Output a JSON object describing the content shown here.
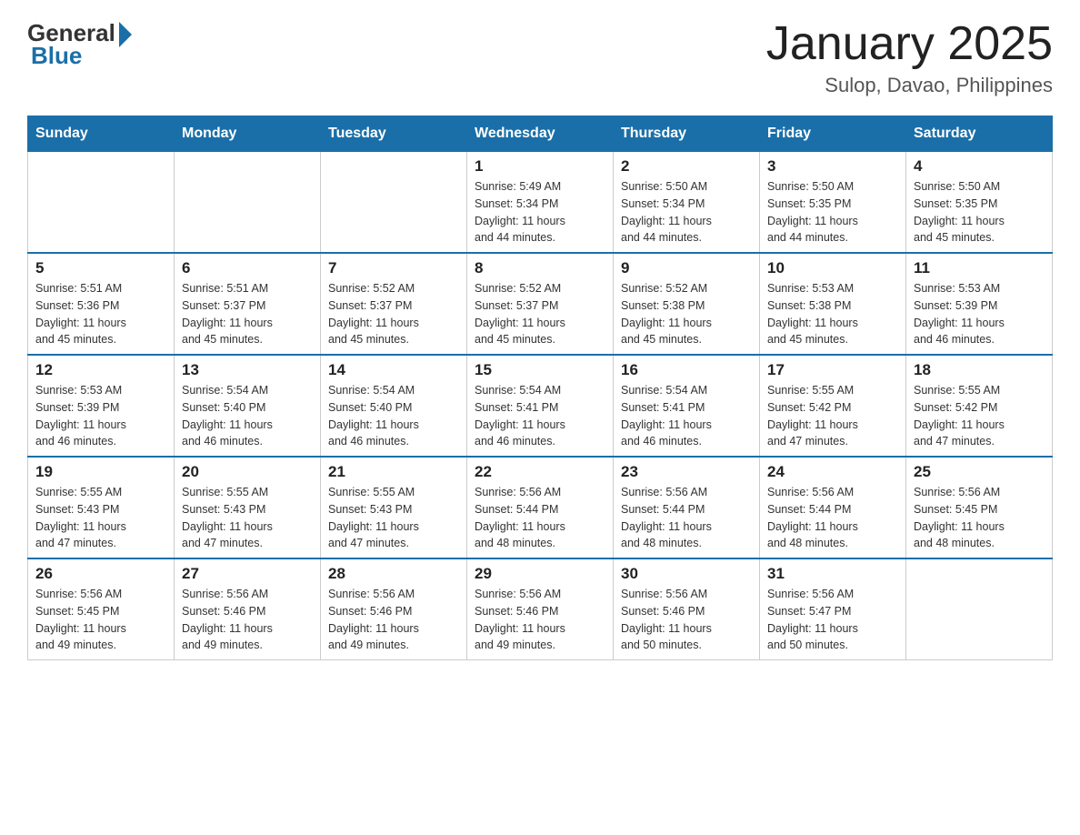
{
  "header": {
    "logo_general": "General",
    "logo_blue": "Blue",
    "month_title": "January 2025",
    "location": "Sulop, Davao, Philippines"
  },
  "weekdays": [
    "Sunday",
    "Monday",
    "Tuesday",
    "Wednesday",
    "Thursday",
    "Friday",
    "Saturday"
  ],
  "weeks": [
    [
      {
        "day": "",
        "info": ""
      },
      {
        "day": "",
        "info": ""
      },
      {
        "day": "",
        "info": ""
      },
      {
        "day": "1",
        "info": "Sunrise: 5:49 AM\nSunset: 5:34 PM\nDaylight: 11 hours\nand 44 minutes."
      },
      {
        "day": "2",
        "info": "Sunrise: 5:50 AM\nSunset: 5:34 PM\nDaylight: 11 hours\nand 44 minutes."
      },
      {
        "day": "3",
        "info": "Sunrise: 5:50 AM\nSunset: 5:35 PM\nDaylight: 11 hours\nand 44 minutes."
      },
      {
        "day": "4",
        "info": "Sunrise: 5:50 AM\nSunset: 5:35 PM\nDaylight: 11 hours\nand 45 minutes."
      }
    ],
    [
      {
        "day": "5",
        "info": "Sunrise: 5:51 AM\nSunset: 5:36 PM\nDaylight: 11 hours\nand 45 minutes."
      },
      {
        "day": "6",
        "info": "Sunrise: 5:51 AM\nSunset: 5:37 PM\nDaylight: 11 hours\nand 45 minutes."
      },
      {
        "day": "7",
        "info": "Sunrise: 5:52 AM\nSunset: 5:37 PM\nDaylight: 11 hours\nand 45 minutes."
      },
      {
        "day": "8",
        "info": "Sunrise: 5:52 AM\nSunset: 5:37 PM\nDaylight: 11 hours\nand 45 minutes."
      },
      {
        "day": "9",
        "info": "Sunrise: 5:52 AM\nSunset: 5:38 PM\nDaylight: 11 hours\nand 45 minutes."
      },
      {
        "day": "10",
        "info": "Sunrise: 5:53 AM\nSunset: 5:38 PM\nDaylight: 11 hours\nand 45 minutes."
      },
      {
        "day": "11",
        "info": "Sunrise: 5:53 AM\nSunset: 5:39 PM\nDaylight: 11 hours\nand 46 minutes."
      }
    ],
    [
      {
        "day": "12",
        "info": "Sunrise: 5:53 AM\nSunset: 5:39 PM\nDaylight: 11 hours\nand 46 minutes."
      },
      {
        "day": "13",
        "info": "Sunrise: 5:54 AM\nSunset: 5:40 PM\nDaylight: 11 hours\nand 46 minutes."
      },
      {
        "day": "14",
        "info": "Sunrise: 5:54 AM\nSunset: 5:40 PM\nDaylight: 11 hours\nand 46 minutes."
      },
      {
        "day": "15",
        "info": "Sunrise: 5:54 AM\nSunset: 5:41 PM\nDaylight: 11 hours\nand 46 minutes."
      },
      {
        "day": "16",
        "info": "Sunrise: 5:54 AM\nSunset: 5:41 PM\nDaylight: 11 hours\nand 46 minutes."
      },
      {
        "day": "17",
        "info": "Sunrise: 5:55 AM\nSunset: 5:42 PM\nDaylight: 11 hours\nand 47 minutes."
      },
      {
        "day": "18",
        "info": "Sunrise: 5:55 AM\nSunset: 5:42 PM\nDaylight: 11 hours\nand 47 minutes."
      }
    ],
    [
      {
        "day": "19",
        "info": "Sunrise: 5:55 AM\nSunset: 5:43 PM\nDaylight: 11 hours\nand 47 minutes."
      },
      {
        "day": "20",
        "info": "Sunrise: 5:55 AM\nSunset: 5:43 PM\nDaylight: 11 hours\nand 47 minutes."
      },
      {
        "day": "21",
        "info": "Sunrise: 5:55 AM\nSunset: 5:43 PM\nDaylight: 11 hours\nand 47 minutes."
      },
      {
        "day": "22",
        "info": "Sunrise: 5:56 AM\nSunset: 5:44 PM\nDaylight: 11 hours\nand 48 minutes."
      },
      {
        "day": "23",
        "info": "Sunrise: 5:56 AM\nSunset: 5:44 PM\nDaylight: 11 hours\nand 48 minutes."
      },
      {
        "day": "24",
        "info": "Sunrise: 5:56 AM\nSunset: 5:44 PM\nDaylight: 11 hours\nand 48 minutes."
      },
      {
        "day": "25",
        "info": "Sunrise: 5:56 AM\nSunset: 5:45 PM\nDaylight: 11 hours\nand 48 minutes."
      }
    ],
    [
      {
        "day": "26",
        "info": "Sunrise: 5:56 AM\nSunset: 5:45 PM\nDaylight: 11 hours\nand 49 minutes."
      },
      {
        "day": "27",
        "info": "Sunrise: 5:56 AM\nSunset: 5:46 PM\nDaylight: 11 hours\nand 49 minutes."
      },
      {
        "day": "28",
        "info": "Sunrise: 5:56 AM\nSunset: 5:46 PM\nDaylight: 11 hours\nand 49 minutes."
      },
      {
        "day": "29",
        "info": "Sunrise: 5:56 AM\nSunset: 5:46 PM\nDaylight: 11 hours\nand 49 minutes."
      },
      {
        "day": "30",
        "info": "Sunrise: 5:56 AM\nSunset: 5:46 PM\nDaylight: 11 hours\nand 50 minutes."
      },
      {
        "day": "31",
        "info": "Sunrise: 5:56 AM\nSunset: 5:47 PM\nDaylight: 11 hours\nand 50 minutes."
      },
      {
        "day": "",
        "info": ""
      }
    ]
  ]
}
